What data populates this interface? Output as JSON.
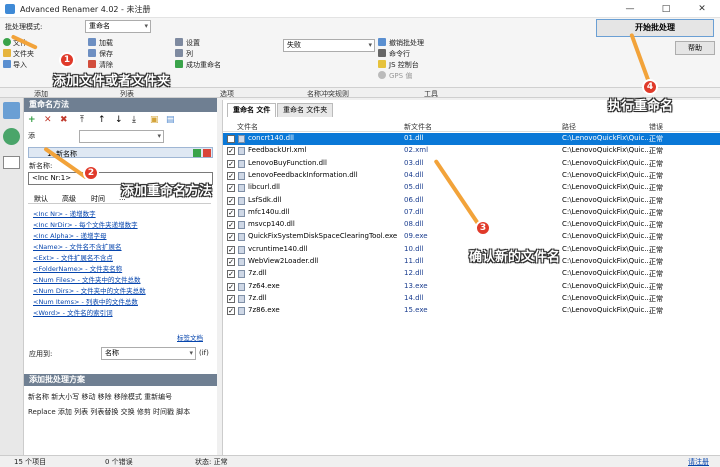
{
  "titlebar": {
    "title": "Advanced Renamer 4.02 - 未注册",
    "minimize": "—",
    "maximize": "□",
    "close": "✕"
  },
  "ribbon": {
    "batch_mode_label": "批处理模式:",
    "batch_mode_value": "重命名",
    "add_menu": [
      "文件",
      "文件夹",
      "导入"
    ],
    "col2": [
      "加载",
      "保存",
      "清除"
    ],
    "col3": [
      "设置",
      "列",
      "成功重命名"
    ],
    "conflict_value": "失败",
    "col5": [
      "撤销批处理",
      "命令行",
      "JS 控制台",
      "GPS 偏"
    ],
    "start_button": "开始批处理",
    "help_button": "帮助"
  },
  "section_labels": [
    "添加",
    "列表",
    "选项",
    "名称冲突规则",
    "工具"
  ],
  "methods": {
    "title": "重命名方法",
    "toolbar_icons": [
      "+",
      "✕",
      "✖",
      "⤒",
      "↑",
      "↓",
      "⤓",
      "▣",
      "▤"
    ],
    "add_label": "添",
    "method_item": "1: 新名称",
    "new_name_label": "新名称:",
    "new_name_value": "<Inc Nr:1>",
    "tabs": [
      "默认",
      "高级",
      "时间",
      "..."
    ],
    "tag_links": [
      "<Inc Nr> - 递增数字",
      "<Inc NrDir> - 每个文件夹递增数字",
      "<Inc Alpha> - 递增字母",
      "<Name> - 文件名不含扩展名",
      "<Ext> - 文件扩展名不含点",
      "<FolderName> - 文件夹名称",
      "<Num Files> - 文件夹中的文件总数",
      "<Num Dirs> - 文件夹中的文件夹总数",
      "<Num Items> - 列表中的文件总数",
      "<Word> - 文件名的索引词"
    ],
    "tag_doc_link": "标签文档",
    "apply_label": "应用到:",
    "apply_value": "名称",
    "apply_suffix": "(if)"
  },
  "batch": {
    "title": "添加批处理方案",
    "row1": "新名称  新大小写  移动  移除  移除模式  重新编号",
    "row2": "Replace  添加  列表  列表替换  交换  修剪  时间戳  脚本"
  },
  "files": {
    "tabs": [
      "重命名 文件",
      "重命名 文件夹"
    ],
    "columns": [
      "文件名",
      "新文件名",
      "路径",
      "错误"
    ],
    "rows": [
      [
        "concrt140.dll",
        "01.dll",
        "C:\\LenovoQuickFix\\Quic...",
        "正常"
      ],
      [
        "FeedbackUrl.xml",
        "02.xml",
        "C:\\LenovoQuickFix\\Quic...",
        "正常"
      ],
      [
        "LenovoBuyFunction.dll",
        "03.dll",
        "C:\\LenovoQuickFix\\Quic...",
        "正常"
      ],
      [
        "LenovoFeedbackInformation.dll",
        "04.dll",
        "C:\\LenovoQuickFix\\Quic...",
        "正常"
      ],
      [
        "libcurl.dll",
        "05.dll",
        "C:\\LenovoQuickFix\\Quic...",
        "正常"
      ],
      [
        "LsfSdk.dll",
        "06.dll",
        "C:\\LenovoQuickFix\\Quic...",
        "正常"
      ],
      [
        "mfc140u.dll",
        "07.dll",
        "C:\\LenovoQuickFix\\Quic...",
        "正常"
      ],
      [
        "msvcp140.dll",
        "08.dll",
        "C:\\LenovoQuickFix\\Quic...",
        "正常"
      ],
      [
        "QuickFixSystemDiskSpaceClearingTool.exe",
        "09.exe",
        "C:\\LenovoQuickFix\\Quic...",
        "正常"
      ],
      [
        "vcruntime140.dll",
        "10.dll",
        "C:\\LenovoQuickFix\\Quic...",
        "正常"
      ],
      [
        "WebView2Loader.dll",
        "11.dll",
        "C:\\LenovoQuickFix\\Quic...",
        "正常"
      ],
      [
        "7z.dll",
        "12.dll",
        "C:\\LenovoQuickFix\\Quic...",
        "正常"
      ],
      [
        "7z64.exe",
        "13.exe",
        "C:\\LenovoQuickFix\\Quic...",
        "正常"
      ],
      [
        "7z.dll",
        "14.dll",
        "C:\\LenovoQuickFix\\Quic...",
        "正常"
      ],
      [
        "7z86.exe",
        "15.exe",
        "C:\\LenovoQuickFix\\Quic...",
        "正常"
      ]
    ]
  },
  "statusbar": {
    "items": "15 个项目",
    "errors": "0 个错误",
    "state": "状态: 正常",
    "register": "请注册"
  },
  "annotations": [
    "添加文件或者文件夹",
    "添加重命名方法",
    "确认新的文件名",
    "执行重命名"
  ],
  "badges": [
    "1",
    "2",
    "3",
    "4"
  ]
}
